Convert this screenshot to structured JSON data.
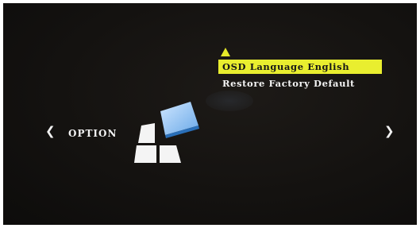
{
  "screen": {
    "section_label": "OPTION",
    "nav_left_icon": "chevron-left-icon",
    "nav_right_icon": "chevron-right-icon",
    "nav_left_glyph": "❮",
    "nav_right_glyph": "❯",
    "category_icon": "option-blocks-icon"
  },
  "menu": {
    "scroll_indicator_icon": "triangle-up-icon",
    "items": [
      {
        "label": "OSD Language English",
        "selected": true
      },
      {
        "label": "Restore Factory Default",
        "selected": false
      }
    ]
  },
  "colors": {
    "background": "#141210",
    "text": "#f4f4f4",
    "highlight": "#e9ee2f",
    "highlight_text": "#161616"
  }
}
